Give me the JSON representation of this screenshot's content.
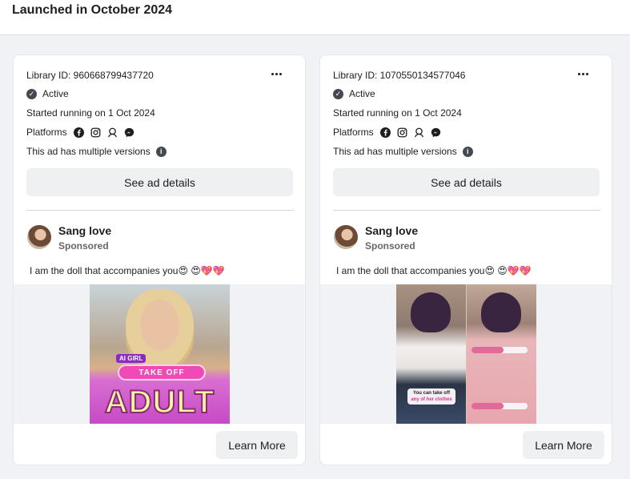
{
  "section": {
    "title": "Launched in October 2024"
  },
  "cards": [
    {
      "library_id": "Library ID: 960668799437720",
      "status": "Active",
      "started": "Started running on 1 Oct 2024",
      "platforms_label": "Platforms",
      "versions_note": "This ad has multiple versions",
      "details_button": "See ad details",
      "page_name": "Sang love",
      "sponsored": "Sponsored",
      "ad_text": "I am the doll that accompanies you😍  😍💖💖",
      "media": {
        "badge": "AI GIRL",
        "pill": "TAKE OFF",
        "headline": "ADULT"
      },
      "cta_button": "Learn More"
    },
    {
      "library_id": "Library ID: 1070550134577046",
      "status": "Active",
      "started": "Started running on 1 Oct 2024",
      "platforms_label": "Platforms",
      "versions_note": "This ad has multiple versions",
      "details_button": "See ad details",
      "page_name": "Sang love",
      "sponsored": "Sponsored",
      "ad_text": "I am the doll that accompanies you😍  😍💖💖",
      "media": {
        "caption_line1": "You can take off",
        "caption_line2": "any of her clothes"
      },
      "cta_button": "Learn More"
    }
  ],
  "icons": {
    "platforms": [
      "facebook-icon",
      "instagram-icon",
      "audience-network-icon",
      "messenger-icon"
    ],
    "status": "check-circle-icon",
    "info": "info-icon",
    "more": "more-options-icon"
  },
  "colors": {
    "button_bg": "#eef0f2",
    "page_bg": "#f0f2f5",
    "text": "#1c1e21",
    "muted": "#65676b"
  }
}
